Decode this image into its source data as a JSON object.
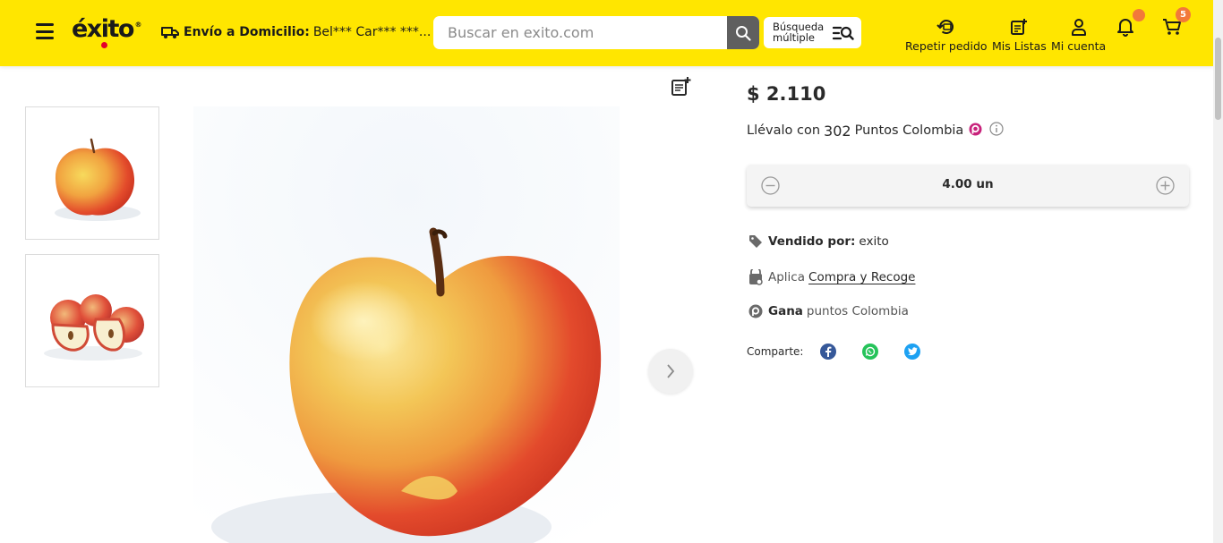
{
  "header": {
    "logo": "éxito",
    "logo_reg": "®",
    "delivery_label": "Envío a Domicilio:",
    "delivery_address": "Bel*** Car*** ***...",
    "search_placeholder": "Buscar en exito.com",
    "multi_search_label_1": "Búsqueda",
    "multi_search_label_2": "múltiple",
    "repeat_order": "Repetir pedido",
    "my_lists": "Mis Listas",
    "my_account": "Mi cuenta",
    "cart_count": "5",
    "accent_color": "#ffe600",
    "badge_color": "#f2793a"
  },
  "product": {
    "price": "$ 2.110",
    "points_prefix": "Llévalo con",
    "points_value": "302",
    "points_suffix": "Puntos Colombia",
    "quantity": "4.00 un",
    "sold_by_label": "Vendido por:",
    "sold_by_value": "exito",
    "pickup_prefix": "Aplica",
    "pickup_link": "Compra y Recoge",
    "earn_label": "Gana",
    "earn_value": "puntos Colombia",
    "share_label": "Comparte:"
  },
  "icons": {
    "menu": "hamburger-icon",
    "delivery": "truck-icon",
    "search": "search-icon",
    "multi_search": "list-search-icon",
    "repeat": "repeat-order-icon",
    "lists": "list-icon",
    "account": "user-icon",
    "notifications": "bell-icon",
    "cart": "cart-icon",
    "add_list": "add-to-list-icon",
    "next": "chevron-right-icon",
    "tag": "tag-icon",
    "store": "store-pickup-icon",
    "points": "puntos-colombia-icon",
    "facebook": "facebook-icon",
    "whatsapp": "whatsapp-icon",
    "twitter": "twitter-icon"
  }
}
